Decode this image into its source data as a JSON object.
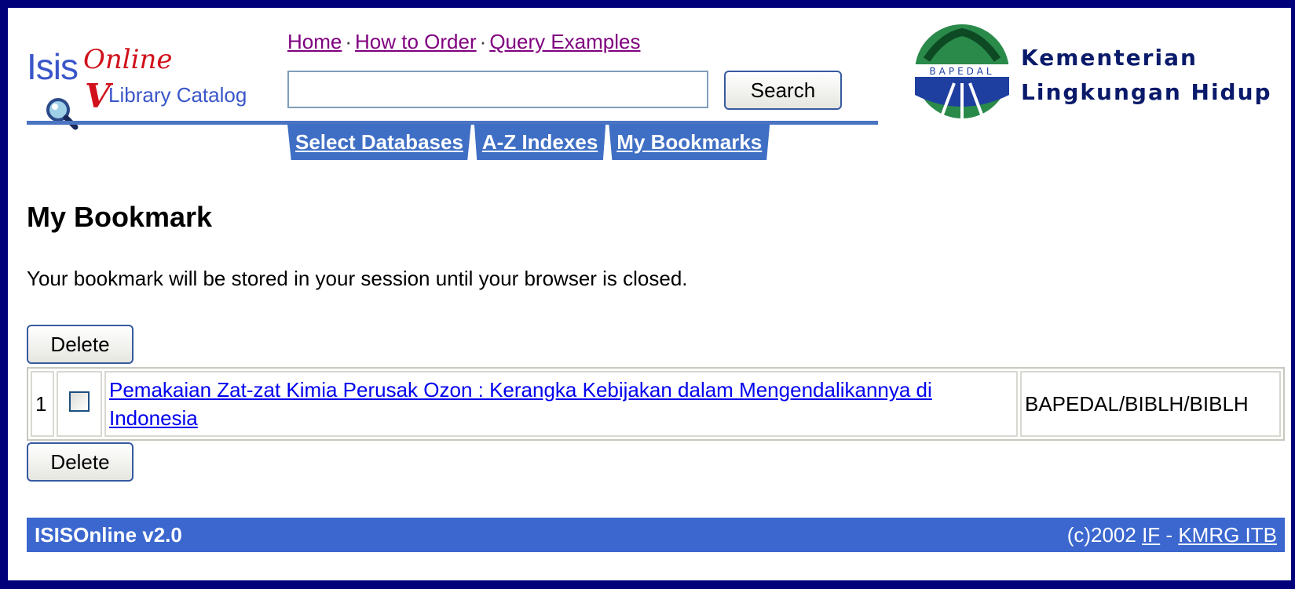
{
  "header": {
    "logo": {
      "isis": "Isis",
      "online": "Online",
      "v": "V",
      "catalog": "Library Catalog"
    },
    "nav_links": [
      "Home",
      "How to Order",
      "Query Examples"
    ],
    "nav_separator": "·",
    "search": {
      "value": "",
      "placeholder": "",
      "button": "Search"
    },
    "ministry": {
      "line1": "Kementerian",
      "line2": "Lingkungan Hidup",
      "seal_text": "BAPEDAL"
    },
    "tabs": [
      "Select Databases",
      "A-Z Indexes",
      "My Bookmarks"
    ]
  },
  "main": {
    "title": "My Bookmark",
    "info": "Your bookmark will be stored in your session until your browser is closed.",
    "delete_label": "Delete",
    "bookmarks": [
      {
        "num": "1",
        "checked": false,
        "title": "Pemakaian Zat-zat Kimia Perusak Ozon : Kerangka Kebijakan dalam Mengendalikannya di Indonesia",
        "db": "BAPEDAL/BIBLH/BIBLH"
      }
    ]
  },
  "footer": {
    "left": "ISISOnline v2.0",
    "copyright": "(c)2002",
    "link1": "IF",
    "separator": "-",
    "link2": "KMRG ITB"
  },
  "colors": {
    "frame": "#00007a",
    "tab_blue": "#3f6fc4",
    "footer_blue": "#3b67cf",
    "visited_link": "#800080",
    "link": "#0000ee"
  }
}
